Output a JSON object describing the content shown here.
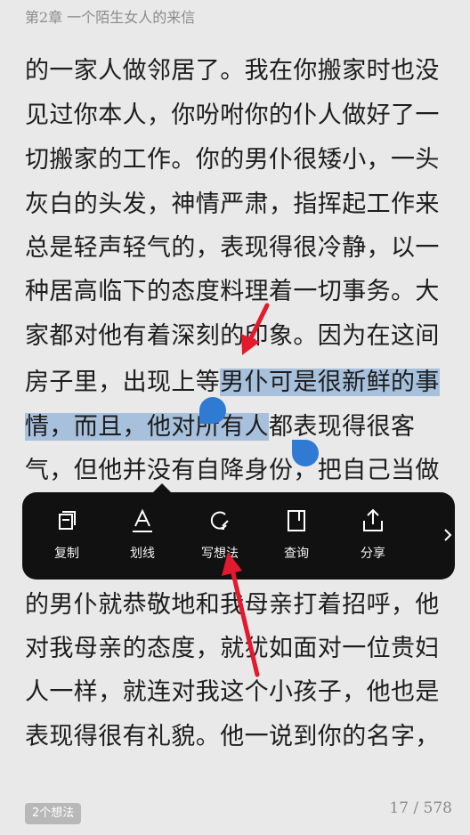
{
  "chapter": "第2章 一个陌生女人的来信",
  "lines": [
    "的一家人做邻居了。我在你搬家时也没",
    "见过你本人，你吩咐你的仆人做好了一",
    "切搬家的工作。你的男仆很矮小，一头",
    "灰白的头发，神情严肃，指挥起工作来",
    "总是轻声轻气的，表现得很冷静，以一",
    "种居高临下的态度料理着一切事务。大",
    "家都对他有着深刻的印象。因为在这间",
    "房子里，出现上等男仆可是很新鲜的事",
    "情，而且，他对所有人都表现得很客",
    "气，但他并没有自降身份，把自己当做",
    "的男仆就恭敬地和我母亲打着招呼，他",
    "对我母亲的态度，就犹如面对一位贵妇",
    "人一样，就连对我这个小孩子，他也是",
    "表现得很有礼貌。他一说到你的名字，"
  ],
  "selection": {
    "line8_plain": "房子里，出现上等",
    "line8_selected": "男仆可是很新鲜的事",
    "line9_selected": "情，而且，他对所有人",
    "line9_plain": "都表现得很客"
  },
  "toolbar": {
    "items": [
      {
        "label": "复制",
        "icon": "copy-icon"
      },
      {
        "label": "划线",
        "icon": "underline-icon"
      },
      {
        "label": "写想法",
        "icon": "write-thought-icon"
      },
      {
        "label": "查询",
        "icon": "lookup-icon"
      },
      {
        "label": "分享",
        "icon": "share-icon"
      }
    ],
    "more_icon": "chevron-right-icon"
  },
  "footer": {
    "thoughts_badge": "2个想法",
    "page": "17 / 578"
  },
  "colors": {
    "background": "#e9e9e9",
    "highlight": "#a7c0dc",
    "handle": "#2f7ad3",
    "toolbar": "#111111",
    "annotation_arrow": "#e3192d"
  }
}
